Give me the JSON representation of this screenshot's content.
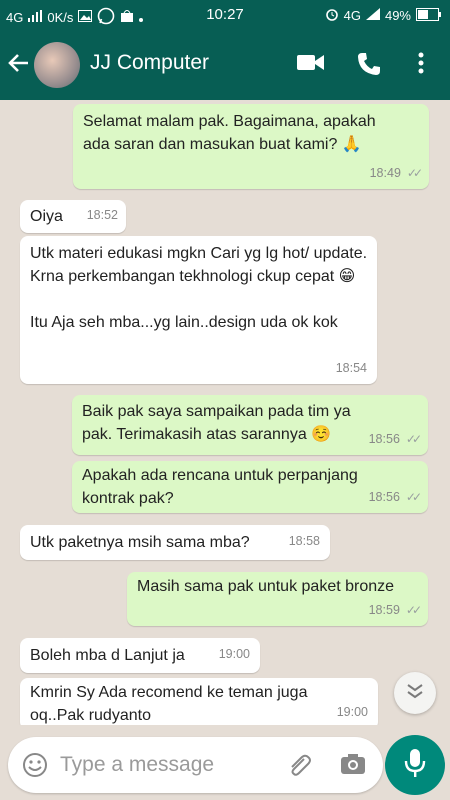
{
  "status": {
    "network_left": "4G",
    "data_speed": "0K/s",
    "clock": "10:27",
    "network_right": "4G",
    "battery": "49%"
  },
  "header": {
    "contact_name": "JJ Computer",
    "back_icon": "arrow-left-icon",
    "video_icon": "video-call-icon",
    "call_icon": "phone-icon",
    "menu_icon": "more-vert-icon"
  },
  "messages": [
    {
      "dir": "out",
      "text": "Selamat malam pak. Bagaimana, apakah ada saran dan masukan buat kami? 🙏",
      "time": "18:49"
    },
    {
      "dir": "in",
      "text": "Oiya",
      "time": "18:52"
    },
    {
      "dir": "in",
      "text": "Utk materi edukasi mgkn Cari yg lg hot/ update. Krna perkembangan tekhnologi ckup cepat 😁\n\nItu Aja seh mba...yg lain..design uda ok kok",
      "time": "18:54"
    },
    {
      "dir": "out",
      "text": "Baik pak saya sampaikan pada tim ya pak. Terimakasih atas sarannya ☺️",
      "time": "18:56"
    },
    {
      "dir": "out",
      "text": "Apakah ada rencana untuk perpanjang kontrak pak?",
      "time": "18:56"
    },
    {
      "dir": "in",
      "text": "Utk paketnya msih sama mba?",
      "time": "18:58"
    },
    {
      "dir": "out",
      "text": "Masih sama pak untuk paket bronze",
      "time": "18:59"
    },
    {
      "dir": "in",
      "text": "Boleh mba d Lanjut ja",
      "time": "19:00"
    },
    {
      "dir": "in",
      "text": "Kmrin Sy Ada recomend ke teman juga oq..Pak rudyanto",
      "time": "19:00"
    }
  ],
  "composer": {
    "placeholder": "Type a message",
    "emoji_icon": "emoji-icon",
    "attach_icon": "paperclip-icon",
    "camera_icon": "camera-icon",
    "mic_icon": "microphone-icon"
  },
  "colors": {
    "header": "#075e54",
    "outgoing_bubble": "#dcf8c6",
    "incoming_bubble": "#ffffff",
    "chat_background": "#e5ddd5",
    "mic_button": "#00897b"
  }
}
